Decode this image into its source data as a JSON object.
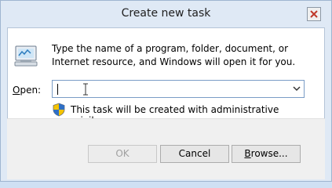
{
  "window": {
    "title": "Create new task"
  },
  "dialog": {
    "description": "Type the name of a program, folder, document, or Internet resource, and Windows will open it for you.",
    "open_label_accel": "O",
    "open_label_rest": "pen:",
    "open_value": "",
    "admin_note": "This task will be created with administrative privileges."
  },
  "buttons": {
    "ok": "OK",
    "cancel": "Cancel",
    "browse_accel": "B",
    "browse_rest": "rowse..."
  },
  "icons": {
    "run": "run-dialog-icon",
    "shield": "uac-shield-icon",
    "close": "close-icon",
    "dropdown": "chevron-down-icon"
  },
  "colors": {
    "title_bg": "#dfe9f5",
    "combo_border": "#7a9cc6",
    "footer_bg": "#f0f0f0"
  }
}
